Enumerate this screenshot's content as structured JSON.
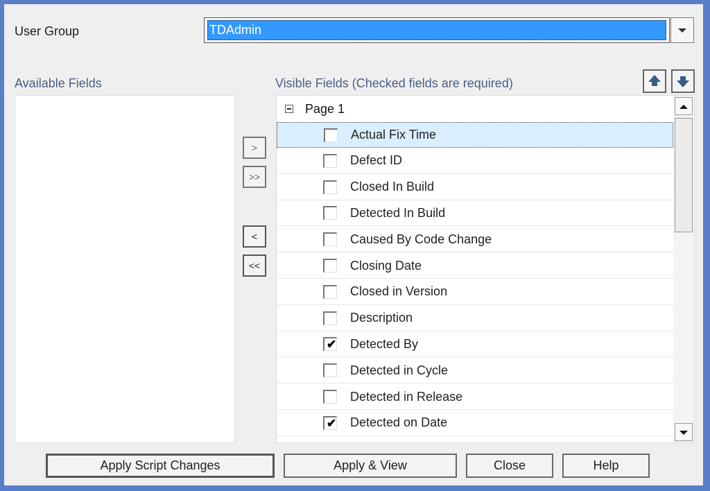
{
  "user_group": {
    "label": "User Group",
    "selected_value": "TDAdmin"
  },
  "available_fields": {
    "label": "Available Fields",
    "items": []
  },
  "visible_fields": {
    "label": "Visible Fields (Checked fields are required)",
    "group": "Page 1",
    "items": [
      {
        "label": "Actual Fix Time",
        "checked": false,
        "selected": true
      },
      {
        "label": "Defect ID",
        "checked": false
      },
      {
        "label": "Closed In Build",
        "checked": false
      },
      {
        "label": "Detected In Build",
        "checked": false
      },
      {
        "label": "Caused By Code Change",
        "checked": false
      },
      {
        "label": "Closing Date",
        "checked": false
      },
      {
        "label": "Closed in Version",
        "checked": false
      },
      {
        "label": "Description",
        "checked": false
      },
      {
        "label": "Detected By",
        "checked": true
      },
      {
        "label": "Detected in Cycle",
        "checked": false
      },
      {
        "label": "Detected in Release",
        "checked": false
      },
      {
        "label": "Detected on Date",
        "checked": true
      }
    ]
  },
  "move_buttons": {
    "add": ">",
    "add_all": ">>",
    "remove": "<",
    "remove_all": "<<"
  },
  "icons": {
    "move_up": "arrow-up-icon",
    "move_down": "arrow-down-icon",
    "dropdown": "chevron-down-icon",
    "check": "✔"
  },
  "buttons": {
    "apply_script": "Apply Script Changes",
    "apply_view": "Apply & View",
    "close": "Close",
    "help": "Help"
  },
  "colors": {
    "selection": "#3399ff",
    "row_highlight": "#d9efff",
    "frame": "#5b7ec9"
  }
}
